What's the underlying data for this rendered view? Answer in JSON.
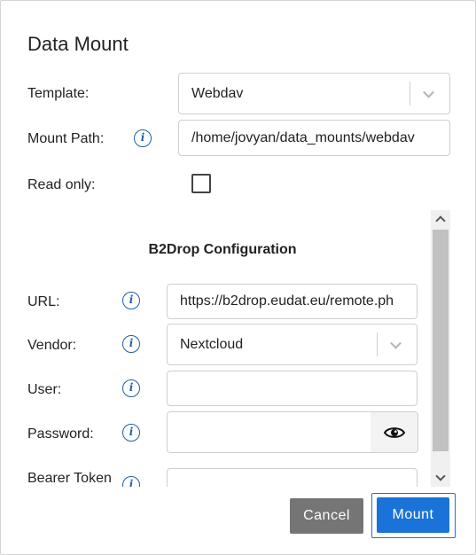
{
  "dialog": {
    "title": "Data Mount"
  },
  "form": {
    "template_label": "Template:",
    "template_value": "Webdav",
    "mount_path_label": "Mount Path:",
    "mount_path_value": "/home/jovyan/data_mounts/webdav",
    "read_only_label": "Read only:",
    "read_only_checked": false
  },
  "config": {
    "section_title": "B2Drop Configuration",
    "url_label": "URL:",
    "url_value": "https://b2drop.eudat.eu/remote.ph",
    "vendor_label": "Vendor:",
    "vendor_value": "Nextcloud",
    "user_label": "User:",
    "user_value": "",
    "password_label": "Password:",
    "password_value": "",
    "bearer_token_label": "Bearer Token",
    "bearer_token_value": ""
  },
  "icons": {
    "info": "info-icon",
    "eye": "eye-icon",
    "chevron": "chevron-down-icon"
  },
  "buttons": {
    "cancel": "Cancel",
    "mount": "Mount"
  },
  "colors": {
    "primary": "#1a73d9",
    "secondary": "#757575",
    "info_icon": "#1f5fa8"
  }
}
